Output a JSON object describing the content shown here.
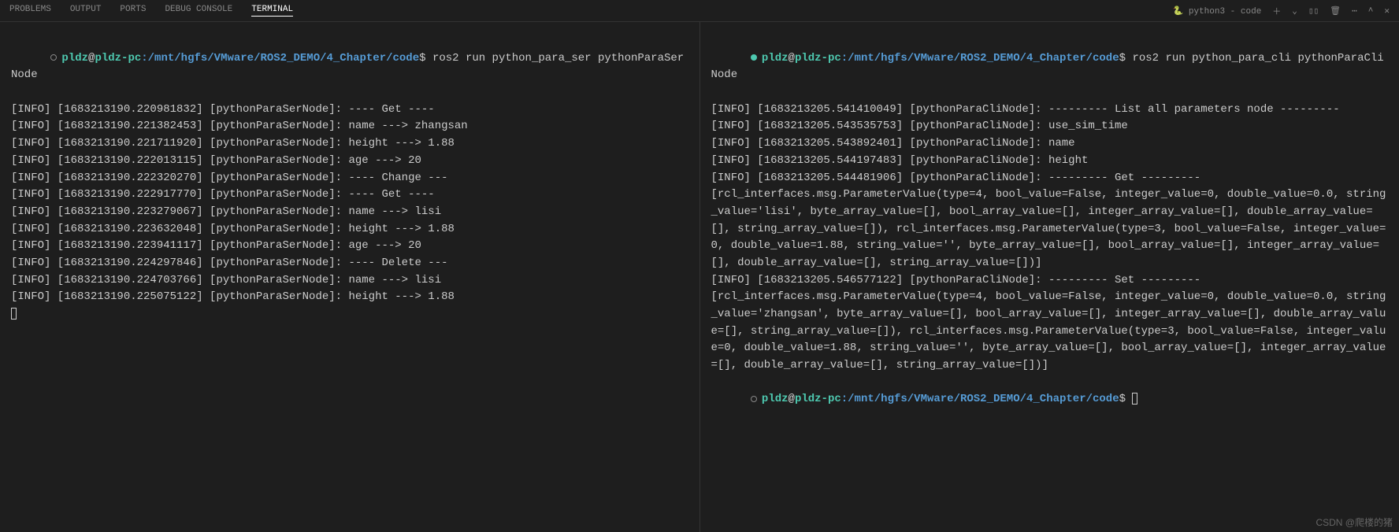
{
  "topbar": {
    "tabs": [
      "PROBLEMS",
      "OUTPUT",
      "PORTS",
      "DEBUG CONSOLE",
      "TERMINAL"
    ],
    "active_tab": "TERMINAL",
    "right_label": "python3 - code",
    "icons": [
      "plus-icon",
      "chevron-down-icon",
      "split-icon",
      "trash-icon",
      "more-icon",
      "chevron-up-icon",
      "close-icon"
    ]
  },
  "prompt": {
    "user": "pldz",
    "host": "pldz-pc",
    "path": "/mnt/hgfs/VMware/ROS2_DEMO/4_Chapter/code",
    "symbol": "$"
  },
  "left": {
    "dot_style": "hollow",
    "command": "ros2 run python_para_ser pythonParaSerNode",
    "lines": [
      "[INFO] [1683213190.220981832] [pythonParaSerNode]: ---- Get ----",
      "[INFO] [1683213190.221382453] [pythonParaSerNode]: name ---> zhangsan",
      "[INFO] [1683213190.221711920] [pythonParaSerNode]: height ---> 1.88",
      "[INFO] [1683213190.222013115] [pythonParaSerNode]: age ---> 20",
      "[INFO] [1683213190.222320270] [pythonParaSerNode]: ---- Change ---",
      "[INFO] [1683213190.222917770] [pythonParaSerNode]: ---- Get ----",
      "[INFO] [1683213190.223279067] [pythonParaSerNode]: name ---> lisi",
      "[INFO] [1683213190.223632048] [pythonParaSerNode]: height ---> 1.88",
      "[INFO] [1683213190.223941117] [pythonParaSerNode]: age ---> 20",
      "[INFO] [1683213190.224297846] [pythonParaSerNode]: ---- Delete ---",
      "[INFO] [1683213190.224703766] [pythonParaSerNode]: name ---> lisi",
      "[INFO] [1683213190.225075122] [pythonParaSerNode]: height ---> 1.88"
    ]
  },
  "right": {
    "dot_style": "filled",
    "command": "ros2 run python_para_cli pythonParaCliNode",
    "lines": [
      "[INFO] [1683213205.541410049] [pythonParaCliNode]: --------- List all parameters node ---------",
      "[INFO] [1683213205.543535753] [pythonParaCliNode]: use_sim_time",
      "[INFO] [1683213205.543892401] [pythonParaCliNode]: name",
      "[INFO] [1683213205.544197483] [pythonParaCliNode]: height",
      "[INFO] [1683213205.544481906] [pythonParaCliNode]: --------- Get ---------",
      "[rcl_interfaces.msg.ParameterValue(type=4, bool_value=False, integer_value=0, double_value=0.0, string_value='lisi', byte_array_value=[], bool_array_value=[], integer_array_value=[], double_array_value=[], string_array_value=[]), rcl_interfaces.msg.ParameterValue(type=3, bool_value=False, integer_value=0, double_value=1.88, string_value='', byte_array_value=[], bool_array_value=[], integer_array_value=[], double_array_value=[], string_array_value=[])]",
      "[INFO] [1683213205.546577122] [pythonParaCliNode]: --------- Set ---------",
      "[rcl_interfaces.msg.ParameterValue(type=4, bool_value=False, integer_value=0, double_value=0.0, string_value='zhangsan', byte_array_value=[], bool_array_value=[], integer_array_value=[], double_array_value=[], string_array_value=[]), rcl_interfaces.msg.ParameterValue(type=3, bool_value=False, integer_value=0, double_value=1.88, string_value='', byte_array_value=[], bool_array_value=[], integer_array_value=[], double_array_value=[], string_array_value=[])]"
    ],
    "show_prompt_after": true
  },
  "watermark": "CSDN @爬楼的猪"
}
